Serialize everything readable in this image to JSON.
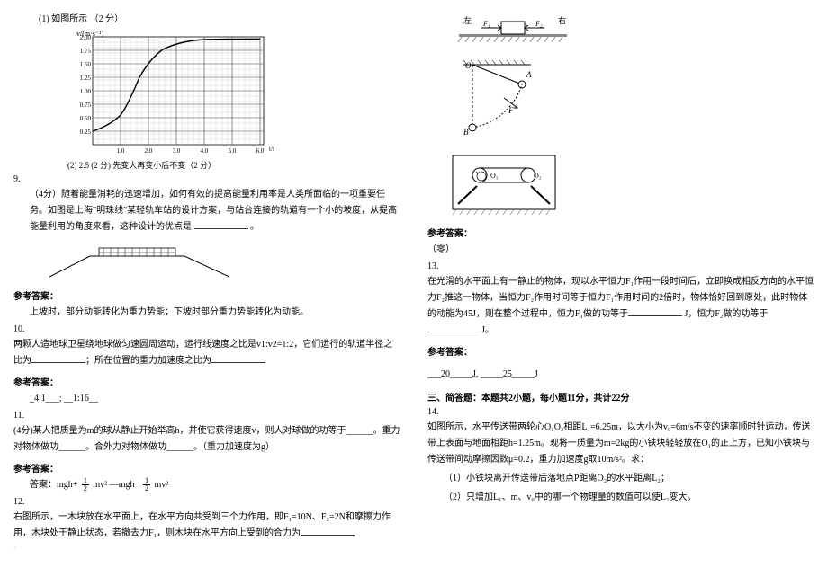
{
  "left": {
    "q8_line1": "(1) 如图所示 （2 分）",
    "chart": {
      "ylab": "v/(m·s⁻¹)",
      "y_ticks": [
        "2.00",
        "1.75",
        "1.50",
        "1.25",
        "1.00",
        "0.75",
        "0.50",
        "0.25"
      ],
      "x_ticks": [
        "1.0",
        "2.0",
        "3.0",
        "4.0",
        "5.0",
        "6.0"
      ],
      "xlab": "t/s"
    },
    "q8_caption": "(2) 2.5 (2 分)     先变大再变小后不变（2 分）",
    "q9_num": "9.",
    "q9_p1": "（4分）随着能量消耗的迅速增加，如何有效的提高能量利用率是人类所面临的一项重要任务。如图是上海\"明珠线\"某轻轨车站的设计方案，与站台连接的轨道有一个小的坡度，从提高能量利用的角度来看，这种设计的优点是",
    "q9_blank_end": "。",
    "ans_label": "参考答案：",
    "q9_ans": "上坡时，部分动能转化为重力势能；下坡时部分重力势能转化为动能。",
    "q10_num": "10.",
    "q10_p": "两颗人造地球卫星绕地球做匀速圆周运动，运行线速度之比是v1:v2=1:2，它们运行的轨道半径之比为",
    "q10_p2": "；所在位置的重力加速度之比为",
    "q10_ans": "_4:1___;   __1:16__",
    "q11_num": "11.",
    "q11_p": "(4分)某人把质量为m的球从静止开始举高h，并使它获得速度v，则人对球做的功等于______。重力对物体做功______。合外力对物体做功______。（重力加速度为g）",
    "q11_ans_prefix": "答案：mgh+",
    "q11_ans_mid1": "mv²    —mgh",
    "q11_ans_mid2": "mv²",
    "q12_num": "12.",
    "q12_p": "右图所示，一木块放在水平面上，在水平方向共受到三个力作用，即F₁=10N、F₂=2N和摩擦力作用，木块处于静止状态，若撤去力F₁，则木块在水平方向上受到的合力为"
  },
  "right": {
    "figA_left": "左",
    "figA_right": "右",
    "figA_F1": "F₁",
    "figA_F2": "F₂",
    "figB_O": "O",
    "figB_A": "A",
    "figB_B": "B",
    "figB_F": "F",
    "figC_O1": "O₁",
    "figC_O2": "O₂",
    "ans_label": "参考答案：",
    "q12_ans": "（零）",
    "q13_num": "13.",
    "q13_p": "在光滑的水平面上有一静止的物体，现以水平恒力F₁作用一段时间后，立即换成相反方向的水平恒力F₂推这一物体，当恒力F₂作用时间等于恒力F₁作用时间的2倍时，物体恰好回到原处，此时物体的动能为45J，则在整个过程中，恒力F₁做的功等于",
    "q13_p2": "J，恒力F₂做的功等于",
    "q13_p3": "J。",
    "q13_ans_l1": "___20_____J,  _____25_____J",
    "sec3_title": "三、简答题：本题共2小题，每小题11分，共计22分",
    "q14_num": "14.",
    "q14_p1": "如图所示，水平传送带两轮心O₁O₂相距L₁=6.25m，以大小为v₀=6m/s不变的速率顺时针运动，传送带上表面与地面相距h=1.25m。现将一质量为m=2kg的小铁块轻轻放在O₁的正上方，已知小铁块与传送带间动摩擦因数μ=0.2，重力加速度g取10m/s²。求：",
    "q14_s1": "（1）小铁块离开传送带后落地点P距离O₂的水平距离L₂；",
    "q14_s2": "（2）只增加L₁、m、v₀中的哪一个物理量的数值可以使L₂变大。"
  },
  "chart_data": {
    "type": "line",
    "xlabel": "t/s",
    "ylabel": "v/(m·s⁻¹)",
    "xlim": [
      0,
      6.5
    ],
    "ylim": [
      0,
      2.1
    ],
    "y_ticks": [
      0.25,
      0.5,
      0.75,
      1.0,
      1.25,
      1.5,
      1.75,
      2.0
    ],
    "x_ticks": [
      1.0,
      2.0,
      3.0,
      4.0,
      5.0,
      6.0
    ],
    "curve": [
      [
        0,
        0.25
      ],
      [
        0.5,
        0.35
      ],
      [
        1.0,
        0.55
      ],
      [
        1.4,
        0.9
      ],
      [
        1.8,
        1.35
      ],
      [
        2.1,
        1.6
      ],
      [
        2.4,
        1.78
      ],
      [
        2.8,
        1.88
      ],
      [
        3.2,
        1.93
      ],
      [
        3.6,
        1.96
      ],
      [
        4.0,
        1.97
      ],
      [
        4.5,
        1.98
      ],
      [
        5.0,
        1.98
      ],
      [
        5.5,
        1.98
      ],
      [
        6.0,
        1.98
      ]
    ]
  }
}
